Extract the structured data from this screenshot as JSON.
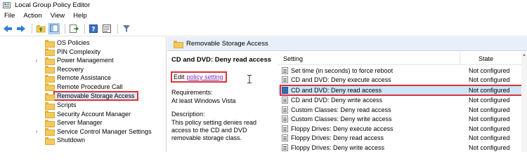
{
  "window": {
    "title": "Local Group Policy Editor"
  },
  "menu": [
    "File",
    "Action",
    "View",
    "Help"
  ],
  "toolbar": {
    "buttons": [
      "back-icon",
      "forward-icon",
      "up-folder-icon",
      "show-hide-tree-icon",
      "export-list-icon",
      "help-icon",
      "properties-icon",
      "filter-icon"
    ]
  },
  "tree": {
    "items": [
      {
        "label": "OS Policies",
        "expandable": false
      },
      {
        "label": "PIN Complexity",
        "expandable": false
      },
      {
        "label": "Power Management",
        "expandable": true
      },
      {
        "label": "Recovery",
        "expandable": false
      },
      {
        "label": "Remote Assistance",
        "expandable": false
      },
      {
        "label": "Remote Procedure Call",
        "expandable": false
      },
      {
        "label": "Removable Storage Access",
        "expandable": false,
        "selected": true
      },
      {
        "label": "Scripts",
        "expandable": false
      },
      {
        "label": "Security Account Manager",
        "expandable": false
      },
      {
        "label": "Server Manager",
        "expandable": false
      },
      {
        "label": "Service Control Manager Settings",
        "expandable": true
      },
      {
        "label": "Shutdown",
        "expandable": false
      }
    ]
  },
  "header": {
    "title": "Removable Storage Access"
  },
  "detail": {
    "title": "CD and DVD: Deny read access",
    "edit_prefix": "Edit",
    "edit_link": "policy setting",
    "requirements_label": "Requirements:",
    "requirements_value": "At least Windows Vista",
    "description_label": "Description:",
    "description_text": "This policy setting denies read access to the CD and DVD removable storage class."
  },
  "list": {
    "columns": {
      "setting": "Setting",
      "state": "State"
    },
    "rows": [
      {
        "name": "Set time (in seconds) to force reboot",
        "state": "Not configured"
      },
      {
        "name": "CD and DVD: Deny execute access",
        "state": "Not configured"
      },
      {
        "name": "CD and DVD: Deny read access",
        "state": "Not configured",
        "selected": true
      },
      {
        "name": "CD and DVD: Deny write access",
        "state": "Not configured"
      },
      {
        "name": "Custom Classes: Deny read access",
        "state": "Not configured"
      },
      {
        "name": "Custom Classes: Deny write access",
        "state": "Not configured"
      },
      {
        "name": "Floppy Drives: Deny execute access",
        "state": "Not configured"
      },
      {
        "name": "Floppy Drives: Deny read access",
        "state": "Not configured"
      },
      {
        "name": "Floppy Drives: Deny write access",
        "state": "Not configured"
      }
    ]
  },
  "colors": {
    "highlight_border": "#e0303a",
    "selection": "#cde6f7",
    "link": "#7a2bbd",
    "header_strip": "#e8eff8"
  }
}
